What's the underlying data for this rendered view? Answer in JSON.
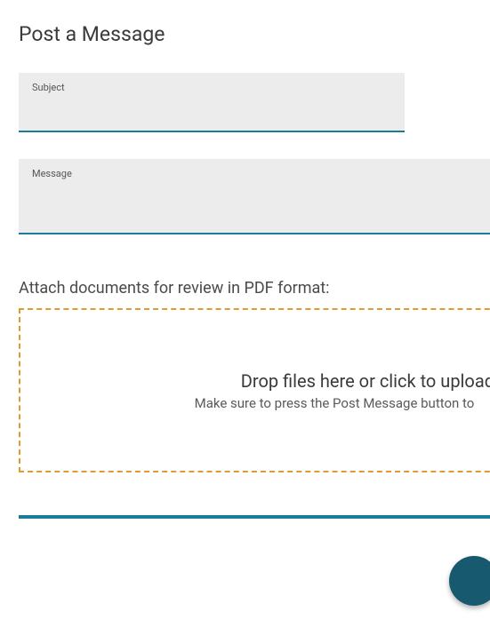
{
  "page": {
    "title": "Post a Message"
  },
  "form": {
    "subject_label": "Subject",
    "subject_value": "",
    "message_label": "Message",
    "message_value": ""
  },
  "attach": {
    "heading": "Attach documents for review in PDF format:",
    "drop_title": "Drop files here or click to upload.",
    "drop_subtitle": "Make sure to press the Post Message button to"
  }
}
